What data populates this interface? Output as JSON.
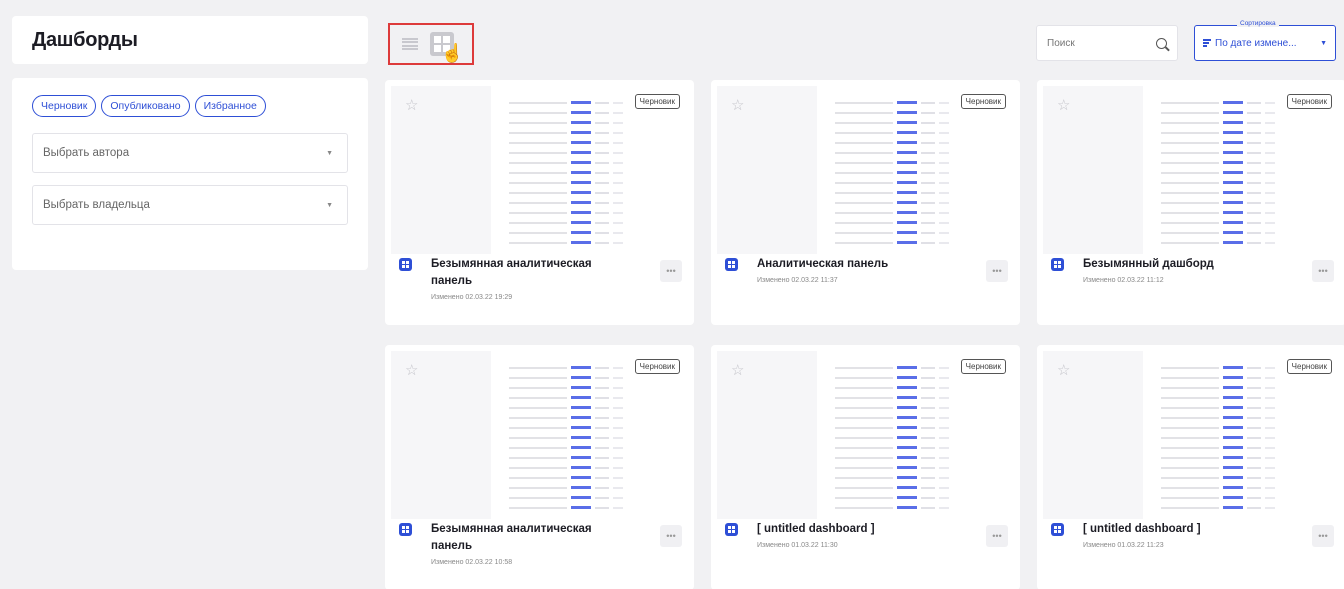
{
  "page": {
    "title": "Дашборды"
  },
  "filters": {
    "chips": [
      "Черновик",
      "Опубликовано",
      "Избранное"
    ],
    "author_select": "Выбрать автора",
    "owner_select": "Выбрать владельца"
  },
  "toolbar": {
    "search_placeholder": "Поиск",
    "sort_label": "Сортировка",
    "sort_value": "По дате измене..."
  },
  "icons": {
    "list_view": "list-icon",
    "grid_view": "grid-icon",
    "search": "search-icon",
    "star": "star-icon",
    "dashboard": "dashboard-icon",
    "more": "more-icon"
  },
  "colors": {
    "accent": "#2e4fd6",
    "highlight": "#dd3a3a"
  },
  "cards": [
    {
      "title": "Безымянная аналитическая панель",
      "date": "Изменено 02.03.22 19:29",
      "badge": "Черновик"
    },
    {
      "title": "Аналитическая панель",
      "date": "Изменено 02.03.22 11:37",
      "badge": "Черновик"
    },
    {
      "title": "Безымянный дашборд",
      "date": "Изменено 02.03.22 11:12",
      "badge": "Черновик"
    },
    {
      "title": "Безымянная аналитическая панель",
      "date": "Изменено 02.03.22 10:58",
      "badge": "Черновик"
    },
    {
      "title": "[ untitled dashboard ]",
      "date": "Изменено 01.03.22 11:30",
      "badge": "Черновик"
    },
    {
      "title": "[ untitled dashboard ]",
      "date": "Изменено 01.03.22 11:23",
      "badge": "Черновик"
    }
  ]
}
